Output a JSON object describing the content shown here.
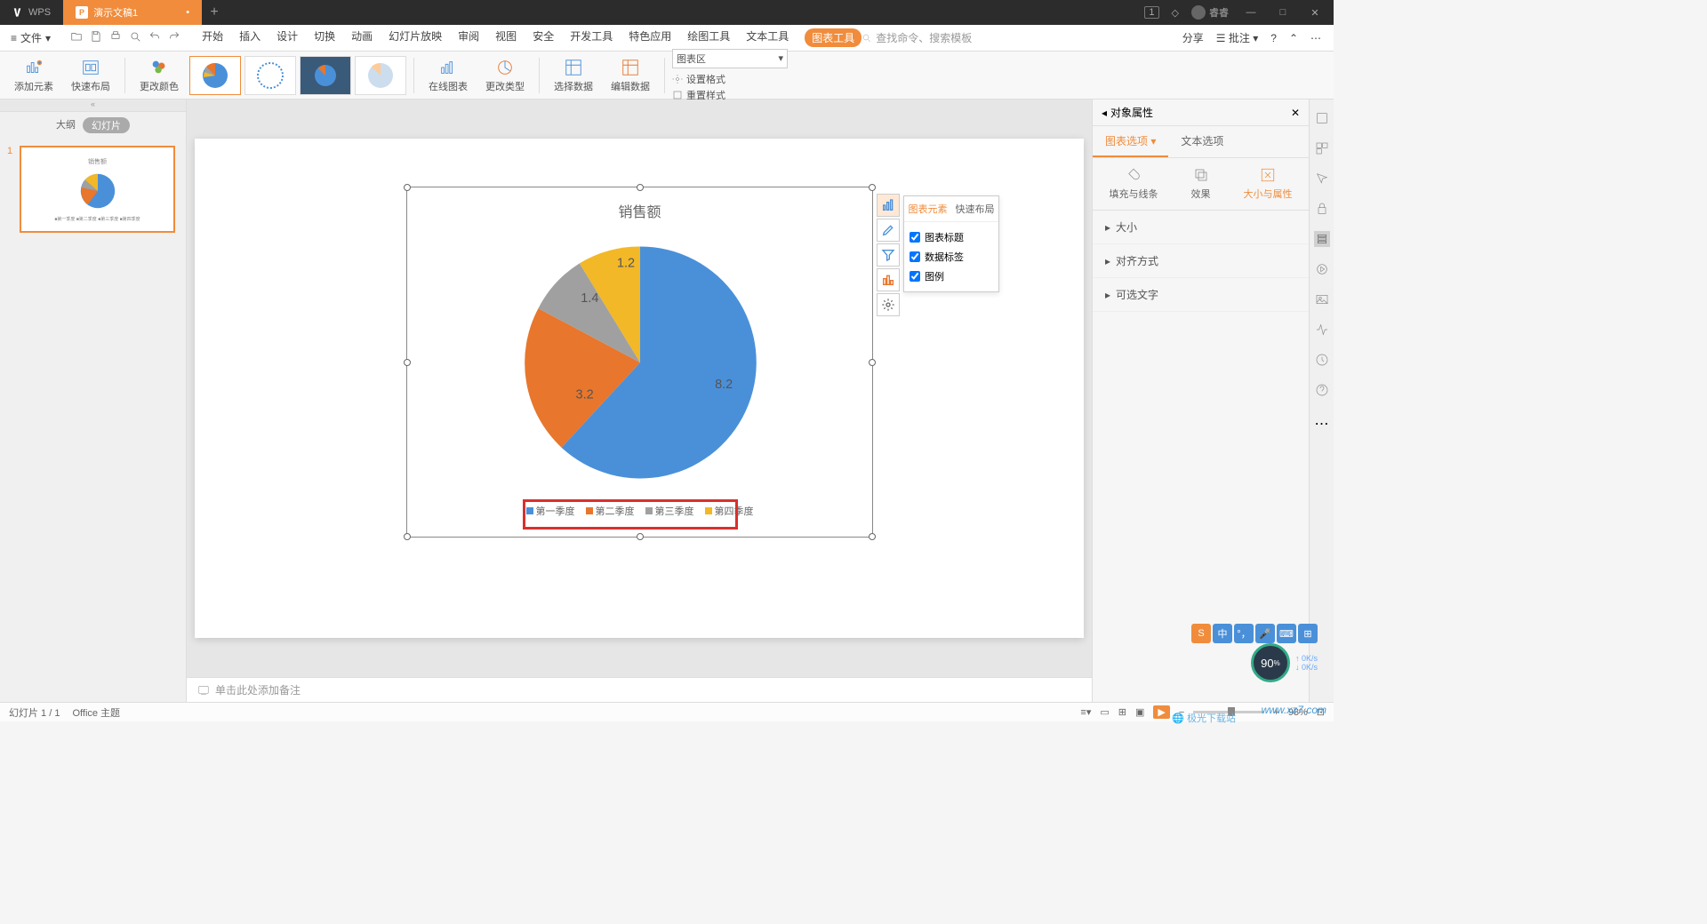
{
  "titlebar": {
    "app": "WPS",
    "doc": "演示文稿1",
    "mod": "•",
    "user": "睿睿",
    "badge": "1"
  },
  "menubar": {
    "file": "文件",
    "items": [
      "开始",
      "插入",
      "设计",
      "切换",
      "动画",
      "幻灯片放映",
      "审阅",
      "视图",
      "安全",
      "开发工具",
      "特色应用",
      "绘图工具",
      "文本工具",
      "图表工具"
    ],
    "active": "图表工具",
    "search_ph": "查找命令、搜索模板",
    "share": "分享",
    "batch": "批注"
  },
  "ribbon": {
    "add_elem": "添加元素",
    "quick_layout": "快速布局",
    "change_color": "更改颜色",
    "online_chart": "在线图表",
    "change_type": "更改类型",
    "select_data": "选择数据",
    "edit_data": "编辑数据",
    "area_combo": "图表区",
    "set_format": "设置格式",
    "reset_style": "重置样式"
  },
  "slide_panel": {
    "outline": "大纲",
    "slides": "幻灯片"
  },
  "chart_data": {
    "type": "pie",
    "title": "销售额",
    "categories": [
      "第一季度",
      "第二季度",
      "第三季度",
      "第四季度"
    ],
    "values": [
      8.2,
      3.2,
      1.4,
      1.2
    ],
    "colors": [
      "#4a90d9",
      "#e8762c",
      "#a0a0a0",
      "#f2b827"
    ],
    "labels": [
      "8.2",
      "3.2",
      "1.4",
      "1.2"
    ]
  },
  "chart_tools": {
    "tab_elem": "图表元素",
    "tab_quick": "快速布局",
    "opts": [
      "图表标题",
      "数据标签",
      "图例"
    ]
  },
  "notes": {
    "placeholder": "单击此处添加备注"
  },
  "prop": {
    "title": "对象属性",
    "tab_chart": "图表选项",
    "tab_text": "文本选项",
    "sub_fill": "填充与线条",
    "sub_effect": "效果",
    "sub_size": "大小与属性",
    "sec_size": "大小",
    "sec_align": "对齐方式",
    "sec_alt": "可选文字"
  },
  "status": {
    "slide": "幻灯片 1 / 1",
    "theme": "Office 主题",
    "zoom": "98%"
  },
  "float": {
    "pct": "90",
    "unit": "%",
    "up": "0K/s",
    "down": "0K/s"
  },
  "ime": {
    "s": "S",
    "zh": "中"
  },
  "watermark": "www.xz7.com",
  "dl": "极光下载站"
}
